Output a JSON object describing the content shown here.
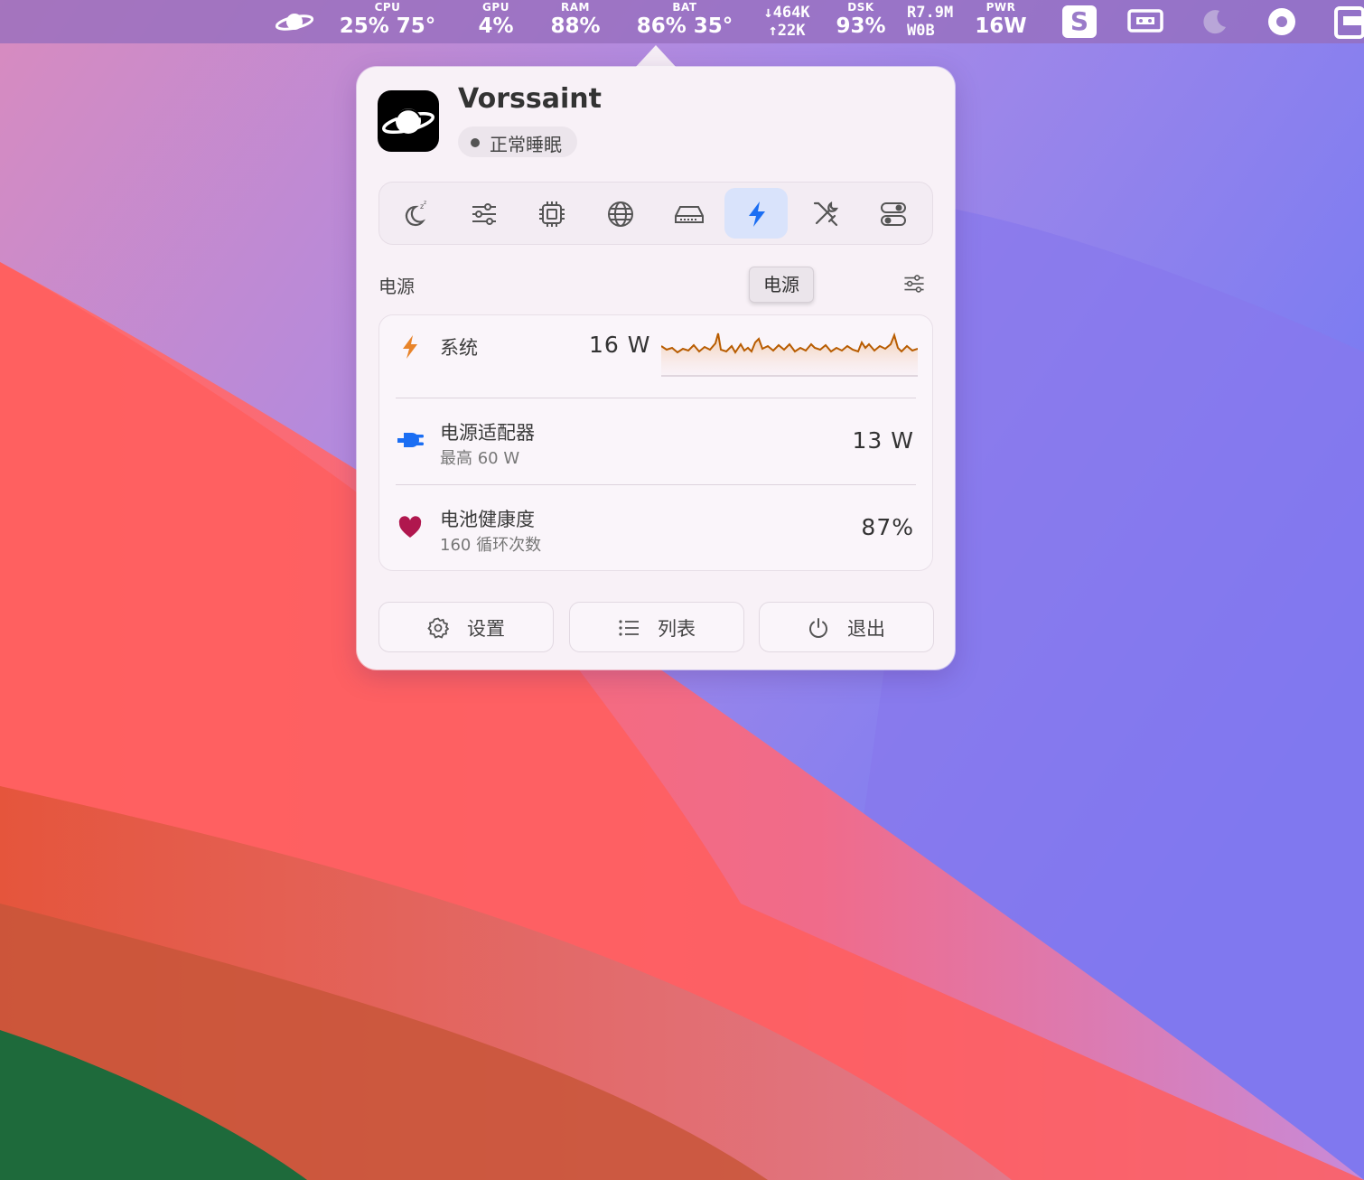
{
  "menubar": {
    "cpu": {
      "label": "CPU",
      "value": "25% 75°"
    },
    "gpu": {
      "label": "GPU",
      "value": "4%"
    },
    "ram": {
      "label": "RAM",
      "value": "88%"
    },
    "bat": {
      "label": "BAT",
      "value": "86% 35°"
    },
    "net": {
      "down": "↓464K",
      "up": "↑22K"
    },
    "dsk": {
      "label": "DSK",
      "value": "93%"
    },
    "disk_io": {
      "read": "R7.9M",
      "write": "W0B"
    },
    "pwr": {
      "label": "PWR",
      "value": "16W"
    },
    "s_icon": "S"
  },
  "popover": {
    "app_name": "Vorssaint",
    "status": "正常睡眠",
    "active_tab": "power",
    "accent_color": "#1b6ef3",
    "section_title": "电源",
    "tooltip": "电源",
    "rows": {
      "system": {
        "label": "系统",
        "value": "16 W"
      },
      "adapter": {
        "label": "电源适配器",
        "sub": "最高 60 W",
        "value": "13 W"
      },
      "battery": {
        "label": "电池健康度",
        "sub": "160 循环次数",
        "value": "87%"
      }
    },
    "buttons": {
      "settings": "设置",
      "list": "列表",
      "quit": "退出"
    },
    "colors": {
      "system_icon": "#e8842a",
      "adapter_icon": "#1b6ef3",
      "battery_icon": "#b0174e",
      "sparkline": "#b85c00"
    }
  }
}
